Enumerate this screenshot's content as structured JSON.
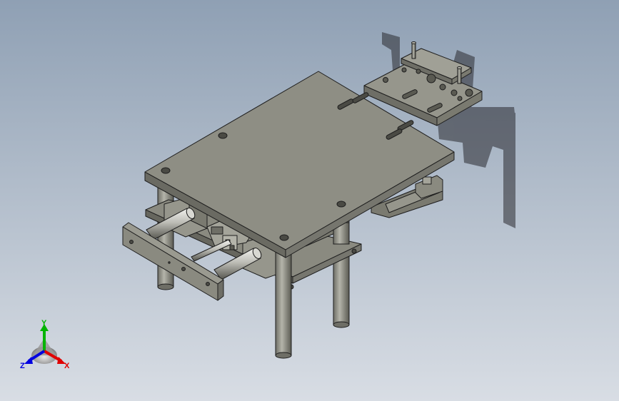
{
  "viewport": {
    "background_top": "#8fa0b4",
    "background_bottom": "#d8dde4",
    "model_color": "#8a8a80",
    "model_edge_color": "#1e1e1e"
  },
  "triad": {
    "x_label": "X",
    "y_label": "Y",
    "z_label": "Z",
    "x_color": "#e00000",
    "y_color": "#00b400",
    "z_color": "#0000e0"
  }
}
